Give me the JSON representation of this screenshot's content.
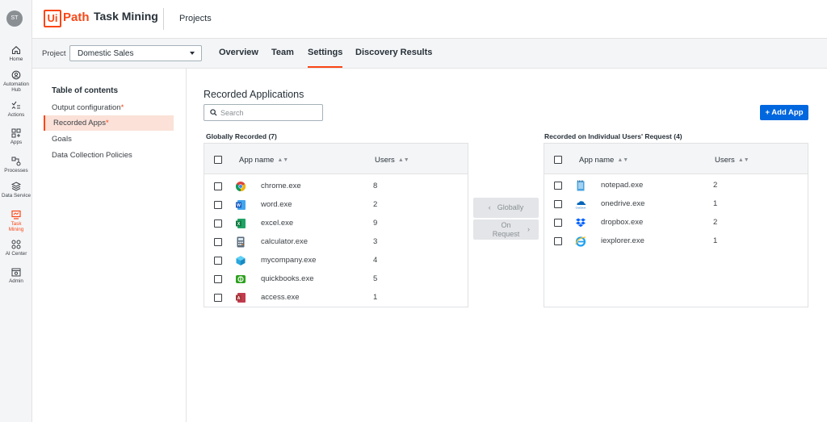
{
  "rail": {
    "avatar": "ST",
    "items": [
      {
        "label": "Home",
        "icon": "home-icon"
      },
      {
        "label": "Automation Hub",
        "icon": "automation-hub-icon"
      },
      {
        "label": "Actions",
        "icon": "actions-icon"
      },
      {
        "label": "Apps",
        "icon": "apps-icon"
      },
      {
        "label": "Processes",
        "icon": "processes-icon"
      },
      {
        "label": "Data Service",
        "icon": "data-service-icon"
      },
      {
        "label": "Task Mining",
        "icon": "task-mining-icon",
        "active": true
      },
      {
        "label": "AI Center",
        "icon": "ai-center-icon"
      },
      {
        "label": "Admin",
        "icon": "admin-icon"
      }
    ]
  },
  "header": {
    "logo_ui": "Ui",
    "logo_path": "Path",
    "product": "Task Mining",
    "projects_link": "Projects"
  },
  "project_bar": {
    "label": "Project",
    "selected": "Domestic Sales",
    "tabs": [
      "Overview",
      "Team",
      "Settings",
      "Discovery Results"
    ],
    "active_tab": "Settings"
  },
  "toc": {
    "title": "Table of contents",
    "items": [
      {
        "label": "Output configuration",
        "required": "*"
      },
      {
        "label": "Recorded Apps",
        "required": "*",
        "active": true
      },
      {
        "label": "Goals"
      },
      {
        "label": "Data Collection Policies"
      }
    ]
  },
  "main": {
    "title": "Recorded Applications",
    "search_placeholder": "Search",
    "add_button": "+ Add App"
  },
  "global_table": {
    "title": "Globally Recorded (7)",
    "col_app": "App name",
    "col_users": "Users",
    "rows": [
      {
        "name": "chrome.exe",
        "users": "8",
        "icon": "chrome-icon"
      },
      {
        "name": "word.exe",
        "users": "2",
        "icon": "word-icon"
      },
      {
        "name": "excel.exe",
        "users": "9",
        "icon": "excel-icon"
      },
      {
        "name": "calculator.exe",
        "users": "3",
        "icon": "calculator-icon"
      },
      {
        "name": "mycompany.exe",
        "users": "4",
        "icon": "mycompany-icon"
      },
      {
        "name": "quickbooks.exe",
        "users": "5",
        "icon": "quickbooks-icon"
      },
      {
        "name": "access.exe",
        "users": "1",
        "icon": "access-icon"
      }
    ]
  },
  "move_buttons": {
    "globally": "Globally",
    "on_request_1": "On",
    "on_request_2": "Request"
  },
  "request_table": {
    "title": "Recorded on Individual Users' Request (4)",
    "col_app": "App name",
    "col_users": "Users",
    "rows": [
      {
        "name": "notepad.exe",
        "users": "2",
        "icon": "notepad-icon"
      },
      {
        "name": "onedrive.exe",
        "users": "1",
        "icon": "onedrive-icon",
        "icon_text": "OneDrive"
      },
      {
        "name": "dropbox.exe",
        "users": "2",
        "icon": "dropbox-icon"
      },
      {
        "name": "iexplorer.exe",
        "users": "1",
        "icon": "iexplorer-icon"
      }
    ]
  },
  "colors": {
    "accent": "#fa4616",
    "primary": "#0067df",
    "toc_active_bg": "#fbe1d8"
  }
}
